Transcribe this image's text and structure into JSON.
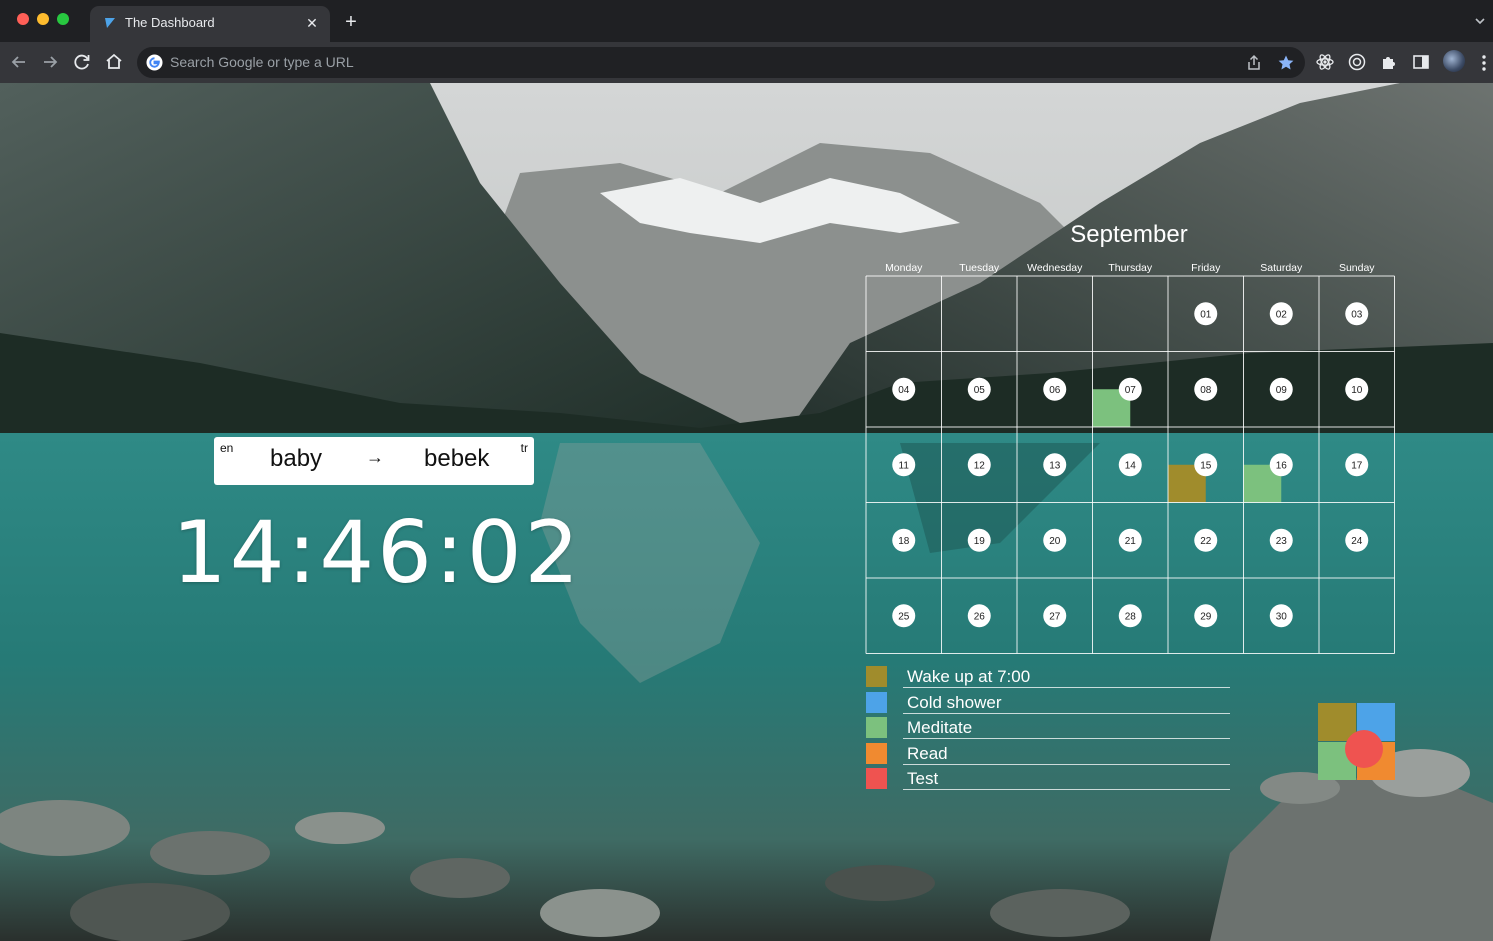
{
  "browser": {
    "tab_title": "The Dashboard",
    "tab_close": "✕",
    "new_tab": "+",
    "omnibox_placeholder": "Search Google or type a URL"
  },
  "translation": {
    "source_lang": "en",
    "target_lang": "tr",
    "source_word": "baby",
    "arrow": "→",
    "target_word": "bebek"
  },
  "clock": {
    "time": "14:46:02"
  },
  "calendar": {
    "month": "September",
    "weekdays": [
      "Monday",
      "Tuesday",
      "Wednesday",
      "Thursday",
      "Friday",
      "Saturday",
      "Sunday"
    ],
    "first_weekday_index": 4,
    "days": [
      "01",
      "02",
      "03",
      "04",
      "05",
      "06",
      "07",
      "08",
      "09",
      "10",
      "11",
      "12",
      "13",
      "14",
      "15",
      "16",
      "17",
      "18",
      "19",
      "20",
      "21",
      "22",
      "23",
      "24",
      "25",
      "26",
      "27",
      "28",
      "29",
      "30"
    ],
    "marks": [
      {
        "day": "07",
        "habit": "Meditate"
      },
      {
        "day": "15",
        "habit": "Wake up at 7:00"
      },
      {
        "day": "16",
        "habit": "Meditate"
      }
    ]
  },
  "habits": [
    {
      "label": "Wake up at 7:00",
      "color": "#a08c2c"
    },
    {
      "label": "Cold shower",
      "color": "#4da3e8"
    },
    {
      "label": "Meditate",
      "color": "#7cc17e"
    },
    {
      "label": "Read",
      "color": "#f08a30"
    },
    {
      "label": "Test",
      "color": "#ef5350"
    }
  ],
  "quad_widget": {
    "colors": [
      "#a08c2c",
      "#4da3e8",
      "#7cc17e",
      "#f08a30"
    ],
    "center_color": "#ef5350"
  }
}
